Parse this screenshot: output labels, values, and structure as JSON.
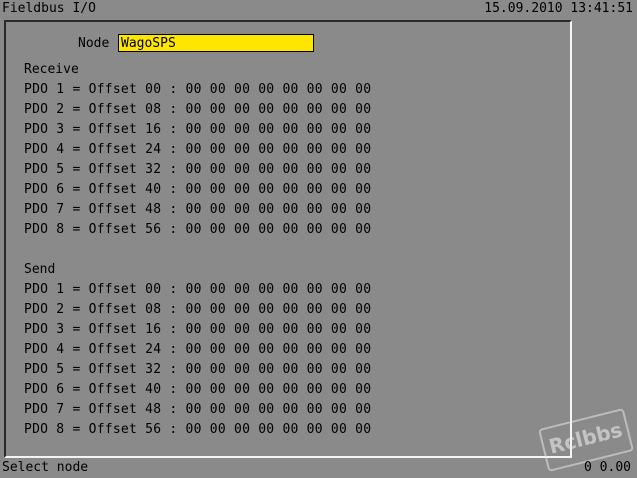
{
  "window": {
    "title": "Fieldbus I/O",
    "datetime": "15.09.2010 13:41:51"
  },
  "node": {
    "label": "Node",
    "value": "WagoSPS"
  },
  "receive": {
    "title": "Receive",
    "rows": [
      "PDO 1 = Offset 00 : 00 00 00 00 00 00 00 00",
      "PDO 2 = Offset 08 : 00 00 00 00 00 00 00 00",
      "PDO 3 = Offset 16 : 00 00 00 00 00 00 00 00",
      "PDO 4 = Offset 24 : 00 00 00 00 00 00 00 00",
      "PDO 5 = Offset 32 : 00 00 00 00 00 00 00 00",
      "PDO 6 = Offset 40 : 00 00 00 00 00 00 00 00",
      "PDO 7 = Offset 48 : 00 00 00 00 00 00 00 00",
      "PDO 8 = Offset 56 : 00 00 00 00 00 00 00 00"
    ]
  },
  "send": {
    "title": "Send",
    "rows": [
      "PDO 1 = Offset 00 : 00 00 00 00 00 00 00 00",
      "PDO 2 = Offset 08 : 00 00 00 00 00 00 00 00",
      "PDO 3 = Offset 16 : 00 00 00 00 00 00 00 00",
      "PDO 4 = Offset 24 : 00 00 00 00 00 00 00 00",
      "PDO 5 = Offset 32 : 00 00 00 00 00 00 00 00",
      "PDO 6 = Offset 40 : 00 00 00 00 00 00 00 00",
      "PDO 7 = Offset 48 : 00 00 00 00 00 00 00 00",
      "PDO 8 = Offset 56 : 00 00 00 00 00 00 00 00"
    ]
  },
  "status": {
    "message": "Select node",
    "value": "0  0.00"
  },
  "watermark": "Rclbbs",
  "colors": {
    "background": "#8a8a8a",
    "input_highlight": "#ffe600"
  }
}
